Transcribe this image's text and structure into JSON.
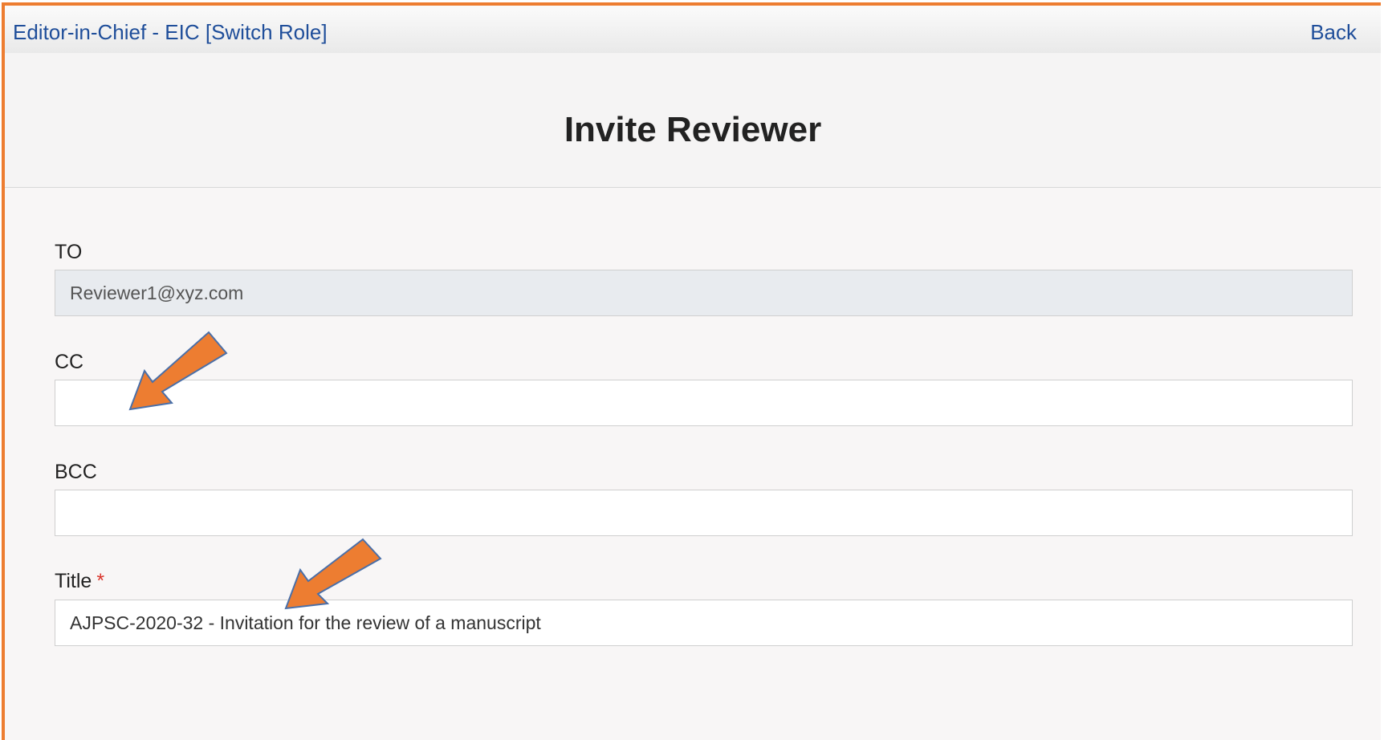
{
  "header": {
    "role_prefix": "Editor-in-Chief - EIC ",
    "switch_role_label": "[Switch Role]",
    "back_label": "Back"
  },
  "page": {
    "title": "Invite Reviewer"
  },
  "form": {
    "to": {
      "label": "TO",
      "value": "Reviewer1@xyz.com"
    },
    "cc": {
      "label": "CC",
      "value": ""
    },
    "bcc": {
      "label": "BCC",
      "value": ""
    },
    "title_field": {
      "label": "Title",
      "required_mark": "*",
      "value": "AJPSC-2020-32 - Invitation for the review of a manuscript"
    }
  },
  "colors": {
    "border_accent": "#ed7d31",
    "link": "#1f4e9a",
    "required": "#d9342b",
    "annotation_arrow": "#ed7d31"
  },
  "annotations": {
    "arrows": [
      {
        "target": "cc-input",
        "icon": "arrow-pointer-icon"
      },
      {
        "target": "title-input",
        "icon": "arrow-pointer-icon"
      }
    ]
  }
}
